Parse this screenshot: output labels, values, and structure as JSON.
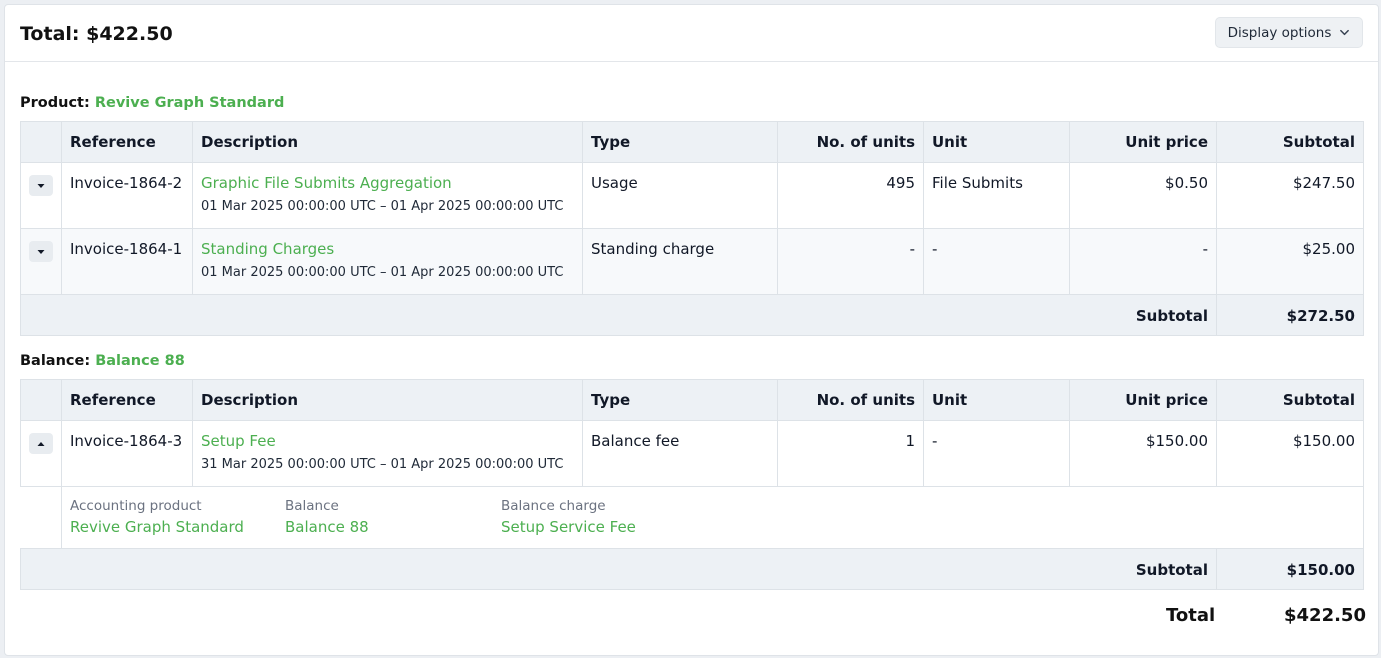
{
  "header": {
    "total_title": "Total: $422.50",
    "display_options_label": "Display options"
  },
  "product_section": {
    "label": "Product:",
    "name": "Revive Graph Standard",
    "columns": [
      "Reference",
      "Description",
      "Type",
      "No. of units",
      "Unit",
      "Unit price",
      "Subtotal"
    ],
    "rows": [
      {
        "reference": "Invoice-1864-2",
        "description": "Graphic File Submits Aggregation",
        "daterange": "01 Mar 2025 00:00:00 UTC – 01 Apr 2025 00:00:00 UTC",
        "type": "Usage",
        "units": "495",
        "unit": "File Submits",
        "unit_price": "$0.50",
        "subtotal": "$247.50",
        "toggle": "chevron-down-icon"
      },
      {
        "reference": "Invoice-1864-1",
        "description": "Standing Charges",
        "daterange": "01 Mar 2025 00:00:00 UTC – 01 Apr 2025 00:00:00 UTC",
        "type": "Standing charge",
        "units": "-",
        "unit": "-",
        "unit_price": "-",
        "subtotal": "$25.00",
        "toggle": "chevron-down-icon"
      }
    ],
    "subtotal_label": "Subtotal",
    "subtotal_value": "$272.50"
  },
  "balance_section": {
    "label": "Balance:",
    "name": "Balance 88",
    "columns": [
      "Reference",
      "Description",
      "Type",
      "No. of units",
      "Unit",
      "Unit price",
      "Subtotal"
    ],
    "rows": [
      {
        "reference": "Invoice-1864-3",
        "description": "Setup Fee",
        "daterange": "31 Mar 2025 00:00:00 UTC – 01 Apr 2025 00:00:00 UTC",
        "type": "Balance fee",
        "units": "1",
        "unit": "-",
        "unit_price": "$150.00",
        "subtotal": "$150.00",
        "toggle": "chevron-up-icon"
      }
    ],
    "details": {
      "accounting_product_label": "Accounting product",
      "accounting_product_value": "Revive Graph Standard",
      "balance_label": "Balance",
      "balance_value": "Balance 88",
      "balance_charge_label": "Balance charge",
      "balance_charge_value": "Setup Service Fee"
    },
    "subtotal_label": "Subtotal",
    "subtotal_value": "$150.00"
  },
  "footer": {
    "total_label": "Total",
    "total_value": "$422.50"
  },
  "colors": {
    "accent_green": "#4caf50",
    "header_bg": "#edf1f5",
    "border": "#dde2e7"
  }
}
